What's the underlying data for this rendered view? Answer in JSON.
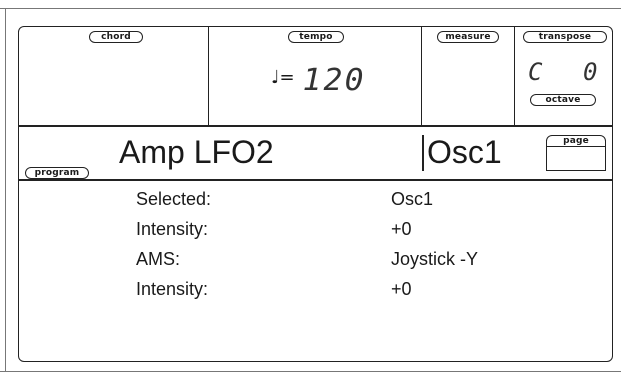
{
  "header": {
    "chord_label": "chord",
    "tempo_label": "tempo",
    "tempo_value": "120",
    "measure_label": "measure",
    "transpose_label": "transpose",
    "transpose_note": "C",
    "transpose_value": "0",
    "octave_label": "octave"
  },
  "title_bar": {
    "program_label": "program",
    "title": "Amp LFO2",
    "oscillator": "Osc1",
    "page_label": "page"
  },
  "params": [
    {
      "label": "Selected:",
      "value": "Osc1"
    },
    {
      "label": "Intensity:",
      "value": "+0"
    },
    {
      "label": "AMS:",
      "value": "Joystick -Y"
    },
    {
      "label": "Intensity:",
      "value": "+0"
    }
  ]
}
